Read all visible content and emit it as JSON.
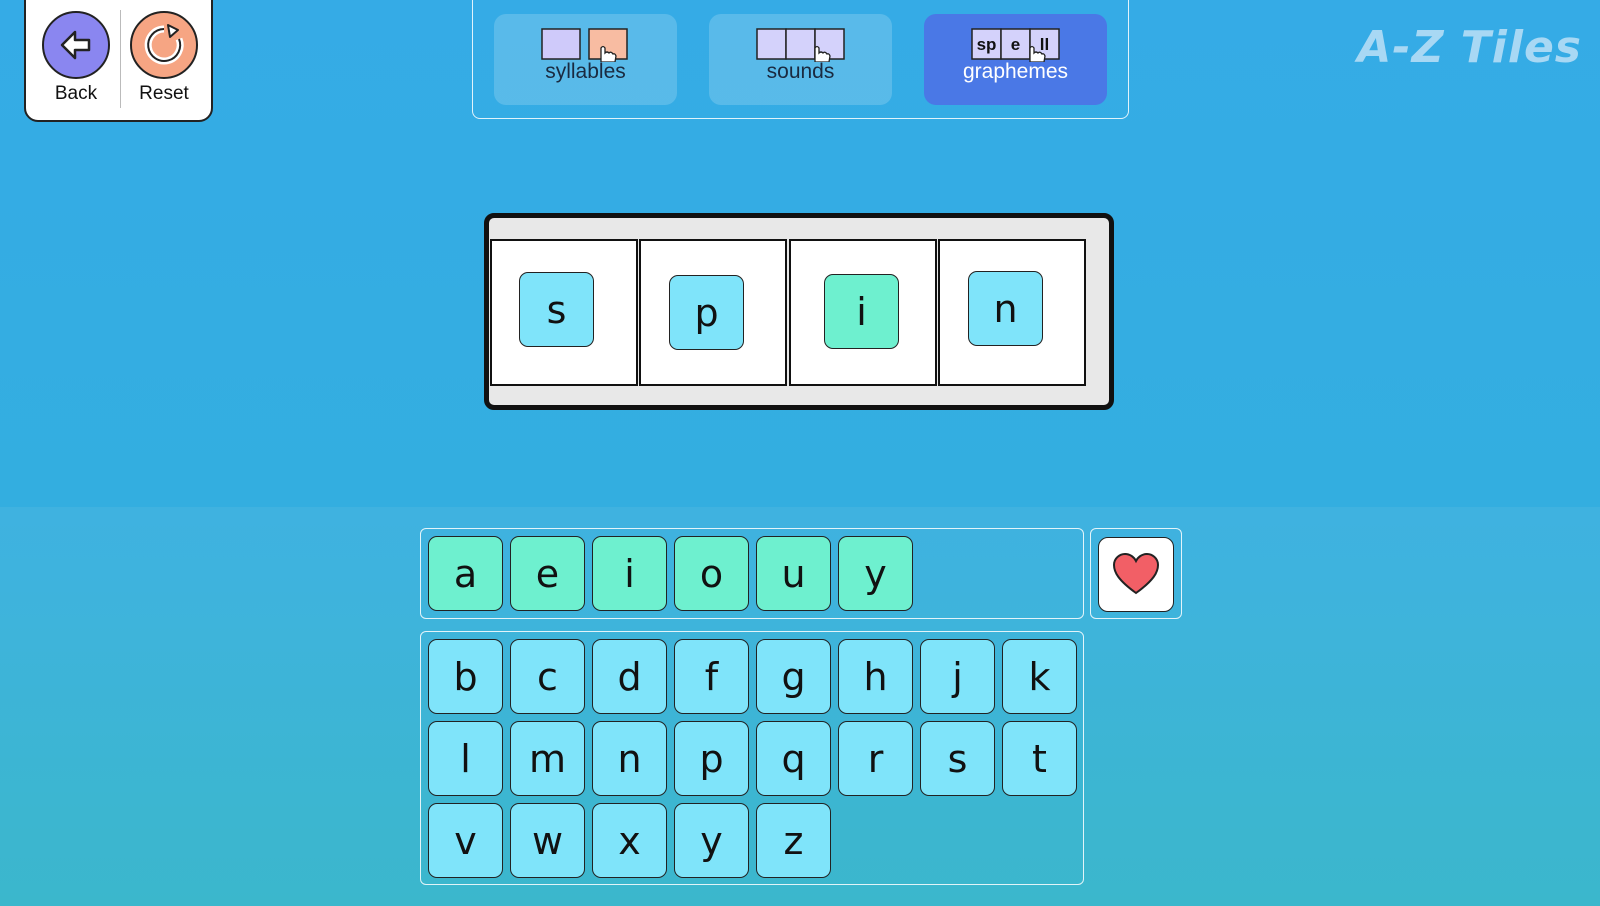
{
  "app_title": "A-Z Tiles",
  "controls": {
    "back_label": "Back",
    "reset_label": "Reset"
  },
  "modes": [
    {
      "label": "syllables",
      "active": false
    },
    {
      "label": "sounds",
      "active": false
    },
    {
      "label": "graphemes",
      "active": true,
      "icon_letters": [
        "sp",
        "e",
        "ll"
      ]
    }
  ],
  "word_slots": [
    {
      "letter": "s",
      "kind": "consonant"
    },
    {
      "letter": "p",
      "kind": "consonant"
    },
    {
      "letter": "i",
      "kind": "vowel"
    },
    {
      "letter": "n",
      "kind": "consonant"
    }
  ],
  "vowels": [
    "a",
    "e",
    "i",
    "o",
    "u",
    "y"
  ],
  "consonants": [
    "b",
    "c",
    "d",
    "f",
    "g",
    "h",
    "j",
    "k",
    "l",
    "m",
    "n",
    "p",
    "q",
    "r",
    "s",
    "t",
    "v",
    "w",
    "x",
    "y",
    "z"
  ],
  "colors": {
    "consonant_tile": "#7fe4fa",
    "vowel_tile": "#6ef0cf",
    "back_button": "#8a86f0",
    "reset_button": "#f6a583",
    "active_mode": "#4a78e6",
    "heart": "#f25f66"
  },
  "icons": {
    "back": "arrow-left-icon",
    "reset": "refresh-icon",
    "favorite": "heart-icon"
  }
}
